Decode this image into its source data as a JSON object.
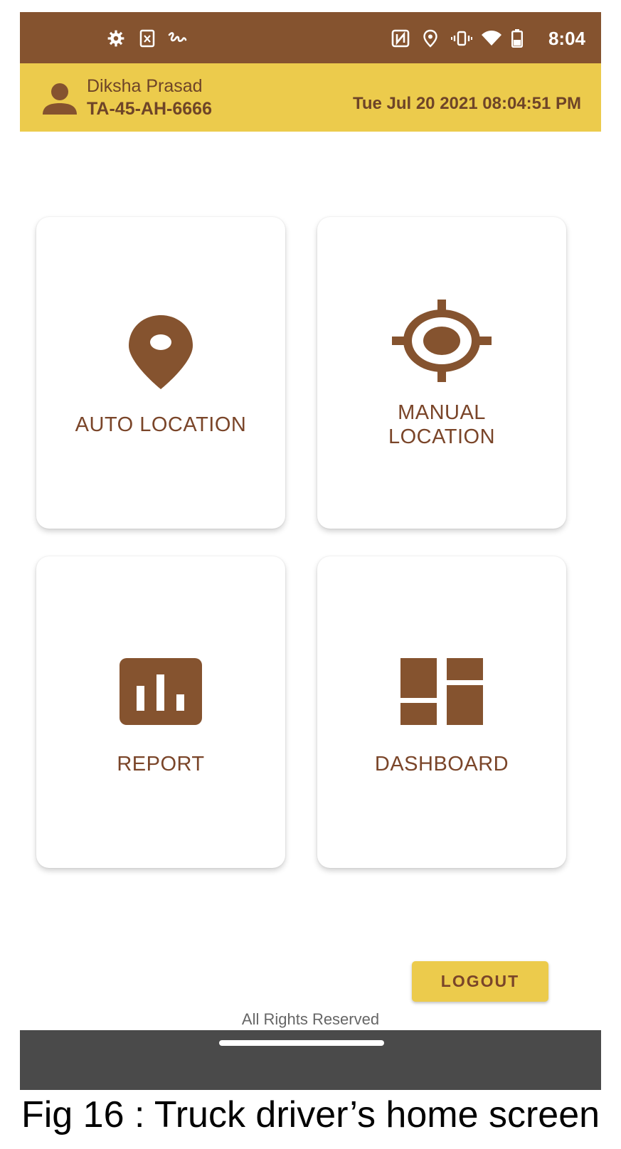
{
  "status_bar": {
    "time": "8:04",
    "left_icons": [
      "settings-icon",
      "sim-card-icon",
      "signature-icon"
    ],
    "right_icons": [
      "nfc-icon",
      "location-icon",
      "vibrate-icon",
      "wifi-icon",
      "battery-icon"
    ]
  },
  "header": {
    "user_name": "Diksha Prasad",
    "vehicle_id": "TA-45-AH-6666",
    "datetime": "Tue Jul 20 2021 08:04:51 PM"
  },
  "menu": {
    "auto_location": {
      "label": "AUTO LOCATION",
      "icon": "location-pin-icon"
    },
    "manual_location": {
      "label_line1": "MANUAL",
      "label_line2": "LOCATION",
      "icon": "crosshair-icon"
    },
    "report": {
      "label": "REPORT",
      "icon": "bar-chart-icon"
    },
    "dashboard": {
      "label": "DASHBOARD",
      "icon": "dashboard-icon"
    }
  },
  "logout_label": "LOGOUT",
  "footer_text": "All Rights Reserved",
  "caption": "Fig 16 : Truck driver’s home screen",
  "colors": {
    "brand_brown": "#85532f",
    "accent_yellow": "#eccb4c",
    "label_brown": "#7a4529"
  }
}
